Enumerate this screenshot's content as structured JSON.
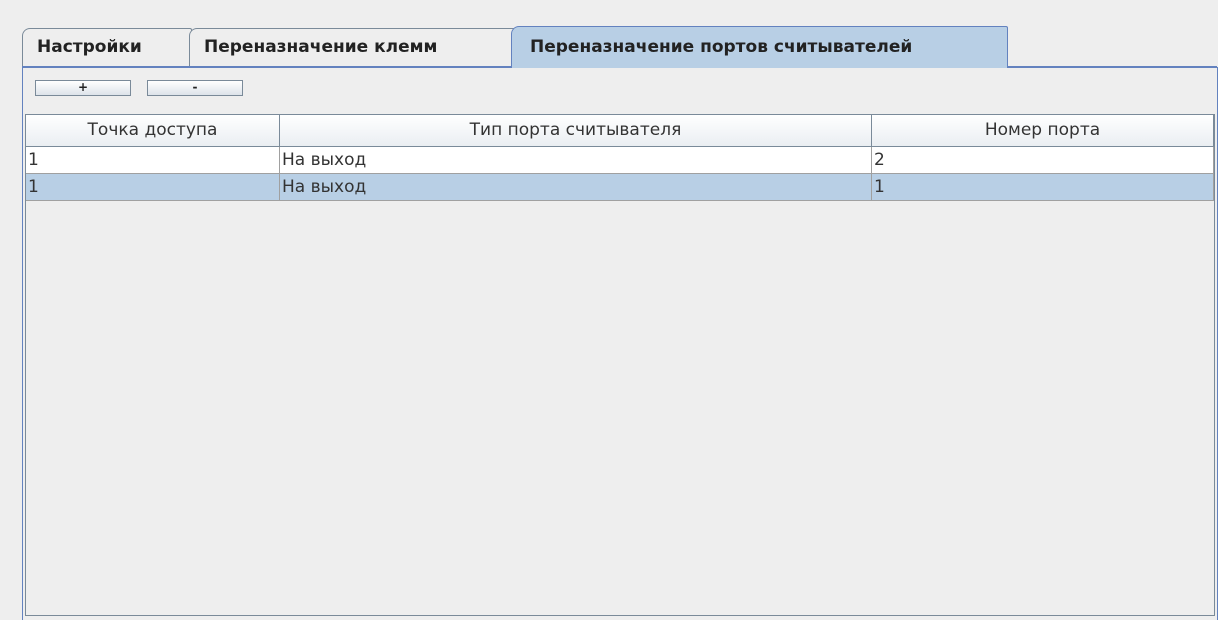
{
  "tabs": [
    {
      "label": "Настройки",
      "selected": false
    },
    {
      "label": "Переназначение клемм",
      "selected": false
    },
    {
      "label": "Переназначение портов считывателей",
      "selected": true
    }
  ],
  "toolbar": {
    "add_label": "+",
    "remove_label": "-"
  },
  "table": {
    "columns": [
      "Точка доступа",
      "Тип порта считывателя",
      "Номер порта"
    ],
    "rows": [
      [
        "1",
        "На выход",
        "2"
      ],
      [
        "1",
        "На выход",
        "1"
      ]
    ],
    "selected_row": 1
  },
  "colors": {
    "selected_tab": "#b8cfe5",
    "selected_row": "#b8cfe5",
    "tab_border_accent": "#6382bf",
    "background": "#eeeeee"
  }
}
